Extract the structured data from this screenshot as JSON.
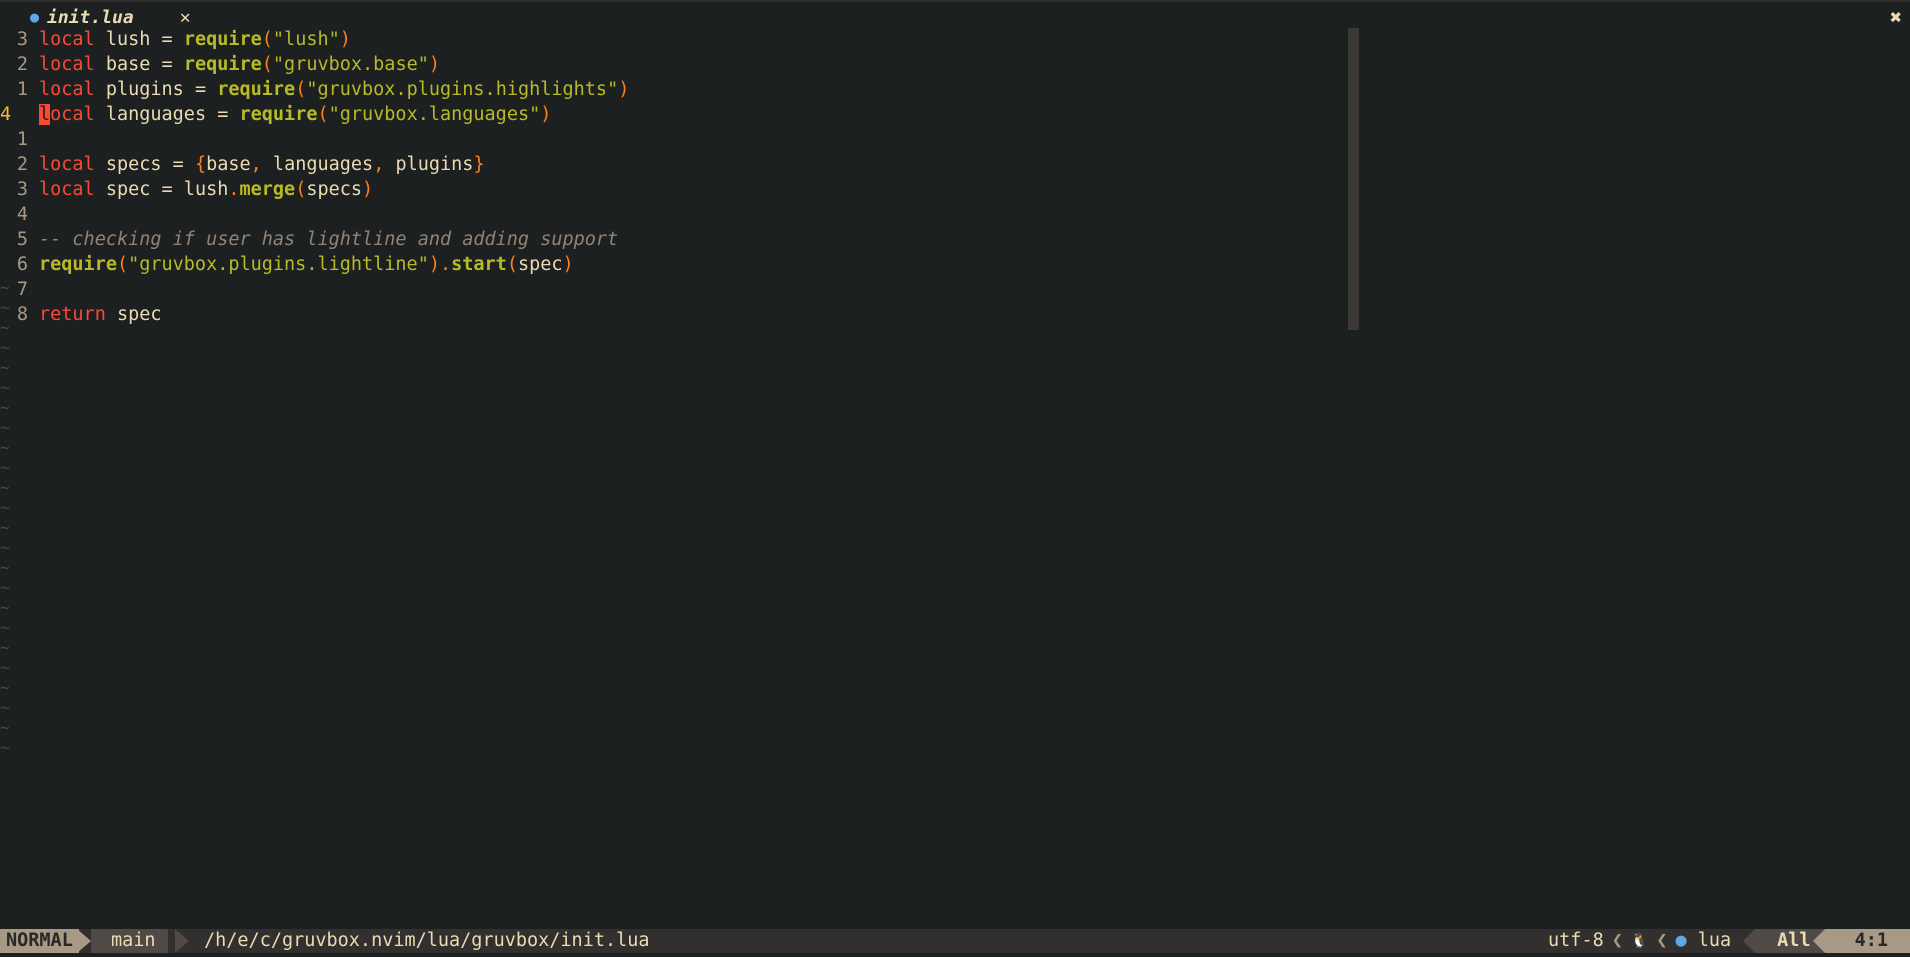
{
  "tab": {
    "filename": "init.lua",
    "close": "✕",
    "window_close": "✖",
    "icon": "lua-icon"
  },
  "colors": {
    "background": "#1d2021",
    "keyword": "#fb4934",
    "function": "#b8bb26",
    "string": "#b8bb26",
    "paren": "#fe8019",
    "comment": "#928374",
    "text": "#ebdbb2",
    "linenr": "#a89984",
    "cursor_linenr": "#fabd2f"
  },
  "lines": [
    {
      "num": "3",
      "tokens": [
        [
          "kw",
          "local"
        ],
        [
          "t",
          " lush = "
        ],
        [
          "fn",
          "require"
        ],
        [
          "paren",
          "("
        ],
        [
          "str",
          "\"lush\""
        ],
        [
          "paren",
          ")"
        ]
      ]
    },
    {
      "num": "2",
      "tokens": [
        [
          "kw",
          "local"
        ],
        [
          "t",
          " base = "
        ],
        [
          "fn",
          "require"
        ],
        [
          "paren",
          "("
        ],
        [
          "str",
          "\"gruvbox.base\""
        ],
        [
          "paren",
          ")"
        ]
      ]
    },
    {
      "num": "1",
      "tokens": [
        [
          "kw",
          "local"
        ],
        [
          "t",
          " plugins = "
        ],
        [
          "fn",
          "require"
        ],
        [
          "paren",
          "("
        ],
        [
          "str",
          "\"gruvbox.plugins.highlights\""
        ],
        [
          "paren",
          ")"
        ]
      ]
    },
    {
      "num": "4",
      "current": true,
      "tokens": [
        [
          "cursor",
          "l"
        ],
        [
          "kw",
          "ocal"
        ],
        [
          "t",
          " languages = "
        ],
        [
          "fn",
          "require"
        ],
        [
          "paren",
          "("
        ],
        [
          "str",
          "\"gruvbox.languages\""
        ],
        [
          "paren",
          ")"
        ]
      ]
    },
    {
      "num": "1",
      "tokens": []
    },
    {
      "num": "2",
      "tokens": [
        [
          "kw",
          "local"
        ],
        [
          "t",
          " specs = "
        ],
        [
          "paren",
          "{"
        ],
        [
          "t",
          "base"
        ],
        [
          "paren",
          ","
        ],
        [
          "t",
          " languages"
        ],
        [
          "paren",
          ","
        ],
        [
          "t",
          " plugins"
        ],
        [
          "paren",
          "}"
        ]
      ]
    },
    {
      "num": "3",
      "tokens": [
        [
          "kw",
          "local"
        ],
        [
          "t",
          " spec = lush"
        ],
        [
          "paren",
          "."
        ],
        [
          "fn",
          "merge"
        ],
        [
          "paren",
          "("
        ],
        [
          "t",
          "specs"
        ],
        [
          "paren",
          ")"
        ]
      ]
    },
    {
      "num": "4",
      "tokens": []
    },
    {
      "num": "5",
      "tokens": [
        [
          "cmt",
          "-- checking if user has lightline and adding support"
        ]
      ]
    },
    {
      "num": "6",
      "tokens": [
        [
          "fn",
          "require"
        ],
        [
          "paren",
          "("
        ],
        [
          "str",
          "\"gruvbox.plugins.lightline\""
        ],
        [
          "paren",
          ")."
        ],
        [
          "fn",
          "start"
        ],
        [
          "paren",
          "("
        ],
        [
          "t",
          "spec"
        ],
        [
          "paren",
          ")"
        ]
      ]
    },
    {
      "num": "7",
      "tokens": []
    },
    {
      "num": "8",
      "tokens": [
        [
          "kw",
          "return"
        ],
        [
          "t",
          " spec"
        ]
      ]
    }
  ],
  "tilde": "~",
  "statusline": {
    "mode": "NORMAL",
    "git_icon": "",
    "branch": "main",
    "path": "/h/e/c/gruvbox.nvim/lua/gruvbox/init.lua",
    "encoding": "utf-8",
    "os_icon": "🐧",
    "filetype": "lua",
    "scroll": "All",
    "position": "4:1"
  }
}
